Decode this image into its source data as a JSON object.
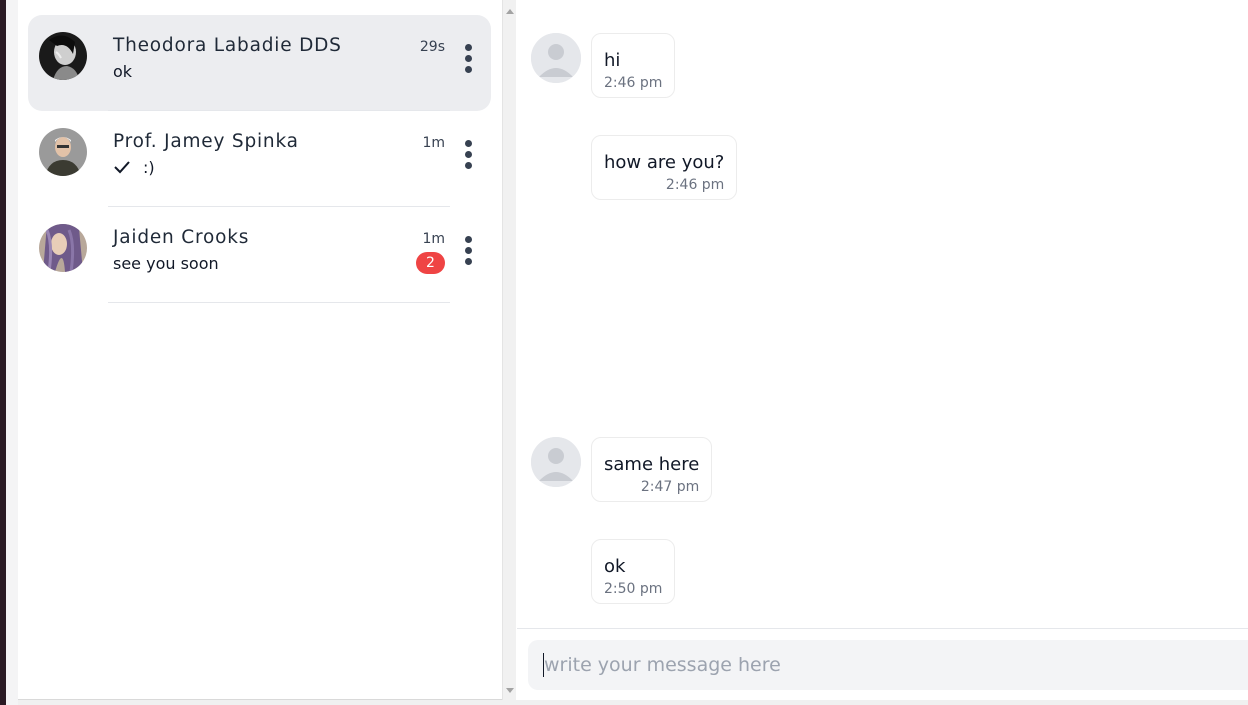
{
  "chat_list": [
    {
      "name": "Theodora Labadie DDS",
      "time": "29s",
      "preview": "ok",
      "active": true,
      "sent_check": false,
      "unread": null
    },
    {
      "name": "Prof. Jamey Spinka",
      "time": "1m",
      "preview": ":)",
      "active": false,
      "sent_check": true,
      "unread": null
    },
    {
      "name": "Jaiden Crooks",
      "time": "1m",
      "preview": "see you soon",
      "active": false,
      "sent_check": false,
      "unread": "2"
    }
  ],
  "messages": [
    {
      "text": "hi",
      "time": "2:46 pm",
      "show_avatar": true
    },
    {
      "text": "how are you?",
      "time": "2:46 pm",
      "show_avatar": false
    },
    {
      "text": "same here",
      "time": "2:47 pm",
      "show_avatar": true
    },
    {
      "text": "ok",
      "time": "2:50 pm",
      "show_avatar": false
    }
  ],
  "composer": {
    "placeholder": "write your message here",
    "value": ""
  },
  "colors": {
    "active_item_bg": "#ecedf0",
    "badge": "#ef4444",
    "kebab": "#374151"
  }
}
